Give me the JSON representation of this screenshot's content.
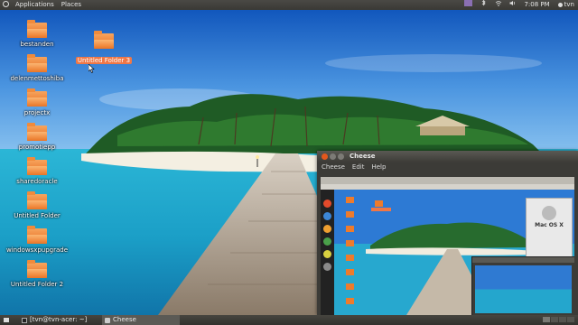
{
  "top_panel": {
    "menus": [
      "Applications",
      "Places"
    ],
    "clock": "7:08 PM",
    "user": "tvn",
    "tray_icons": [
      "mail-icon",
      "bluetooth-icon",
      "network-icon",
      "volume-icon",
      "power-icon",
      "user-icon"
    ]
  },
  "desktop": {
    "icons": [
      {
        "label": "bestanden"
      },
      {
        "label": "delenmettoshiba"
      },
      {
        "label": "projectx"
      },
      {
        "label": "promotiepp"
      },
      {
        "label": "sharedoracle"
      },
      {
        "label": "Untitled Folder"
      },
      {
        "label": "windowsxpupgrade"
      },
      {
        "label": "Untitled Folder 2"
      }
    ],
    "selected_icon": {
      "label": "Untitled Folder 3"
    }
  },
  "cheese": {
    "title": "Cheese",
    "menu": [
      "Cheese",
      "Edit",
      "Help"
    ],
    "about": {
      "os": "Mac OS X"
    }
  },
  "bottom_panel": {
    "tasks": [
      {
        "label": "[tvn@tvn-acer: ~]"
      },
      {
        "label": "Cheese"
      }
    ]
  },
  "colors": {
    "panel": "#3c3b37",
    "selection": "#f07746",
    "folder": "#e66a1f",
    "close_button": "#e3581c"
  }
}
